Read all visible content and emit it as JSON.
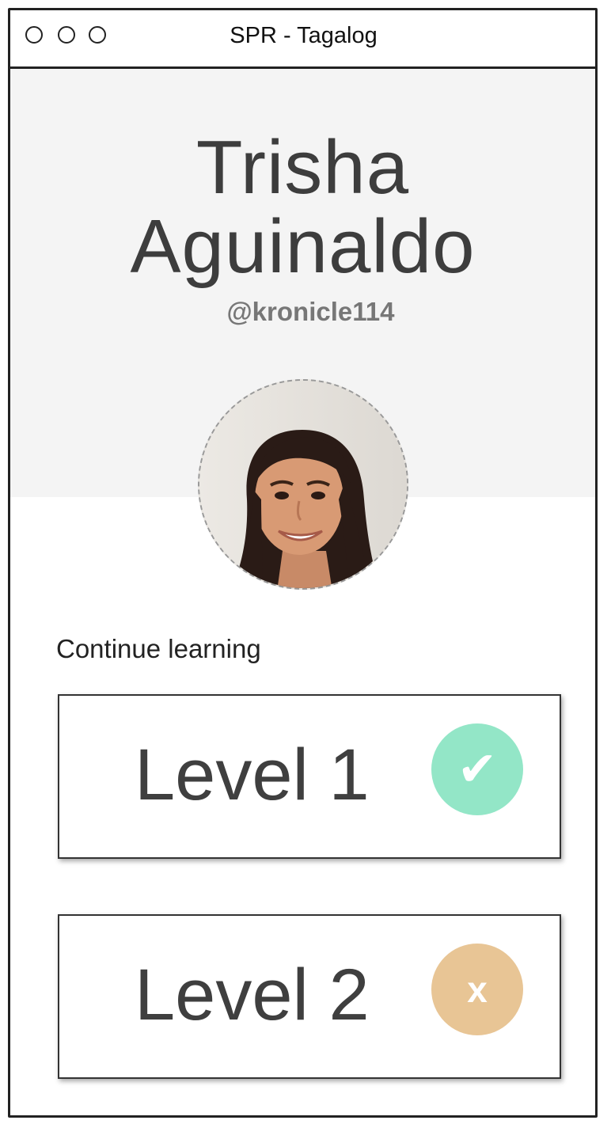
{
  "window": {
    "title": "SPR  - Tagalog"
  },
  "profile": {
    "first_name": "Trisha",
    "last_name": "Aguinaldo",
    "handle": "@kronicle114",
    "avatar_icon": "profile-photo"
  },
  "main": {
    "section_label": "Continue learning",
    "levels": [
      {
        "label": "Level 1",
        "status": "completed",
        "status_symbol": "✔",
        "status_color": "#93e6c7"
      },
      {
        "label": "Level 2",
        "status": "incomplete",
        "status_symbol": "x",
        "status_color": "#e8c595"
      }
    ]
  },
  "colors": {
    "hero_bg": "#f4f4f4",
    "text_dark": "#3d3d3d",
    "handle": "#777777"
  }
}
